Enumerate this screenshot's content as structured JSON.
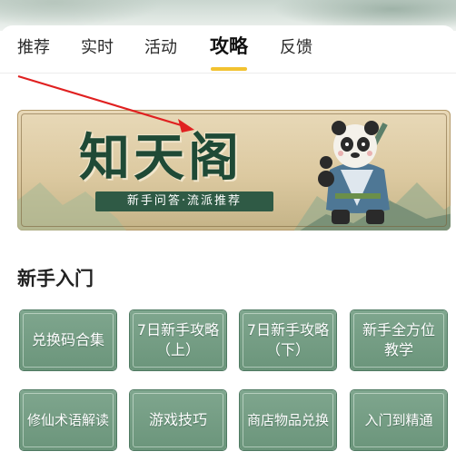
{
  "tabs": [
    {
      "label": "推荐"
    },
    {
      "label": "实时"
    },
    {
      "label": "活动"
    },
    {
      "label": "攻略",
      "active": true
    },
    {
      "label": "反馈"
    }
  ],
  "banner": {
    "title": "知天阁",
    "subtitle": "新手问答·流派推荐"
  },
  "section": {
    "title": "新手入门"
  },
  "buttons": [
    {
      "label": "兑换码合集"
    },
    {
      "label": "7日新手攻略\n（上）"
    },
    {
      "label": "7日新手攻略\n（下）"
    },
    {
      "label": "新手全方位\n教学"
    },
    {
      "label": "修仙术语解读"
    },
    {
      "label": "游戏技巧"
    },
    {
      "label": "商店物品兑换"
    },
    {
      "label": "入门到精通"
    }
  ],
  "colors": {
    "accent_underline": "#f2c230",
    "button_green": "#6b957b",
    "annotation_arrow": "#e02020"
  }
}
